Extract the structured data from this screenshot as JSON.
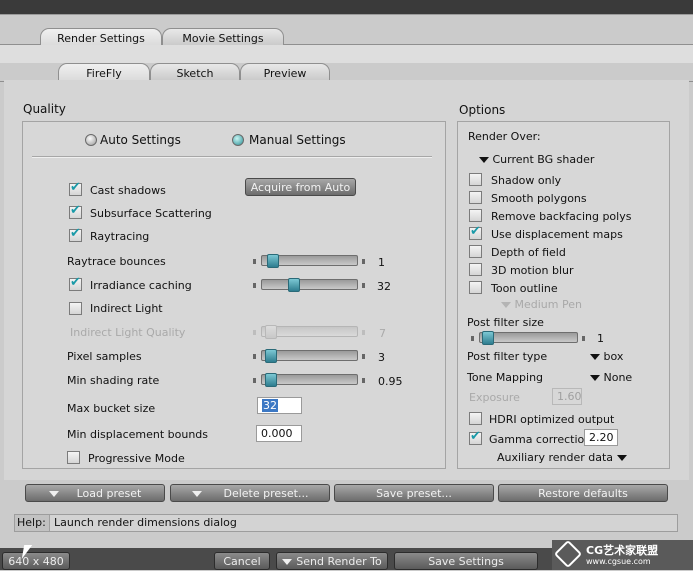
{
  "tabs_top": [
    {
      "label": "Render Settings",
      "active": true
    },
    {
      "label": "Movie Settings",
      "active": false
    }
  ],
  "tabs_sub": [
    {
      "label": "FireFly",
      "active": true
    },
    {
      "label": "Sketch",
      "active": false
    },
    {
      "label": "Preview",
      "active": false
    }
  ],
  "quality": {
    "title": "Quality",
    "auto_label": "Auto Settings",
    "manual_label": "Manual Settings",
    "mode": "manual",
    "cast_shadows": "Cast shadows",
    "subsurface": "Subsurface Scattering",
    "raytracing": "Raytracing",
    "acquire_button": "Acquire from Auto",
    "raytrace_bounces_label": "Raytrace bounces",
    "raytrace_bounces_value": "1",
    "irradiance_label": "Irradiance caching",
    "irradiance_value": "32",
    "indirect_light": "Indirect Light",
    "indirect_quality_label": "Indirect Light Quality",
    "indirect_quality_value": "7",
    "pixel_samples_label": "Pixel samples",
    "pixel_samples_value": "3",
    "min_shading_label": "Min shading rate",
    "min_shading_value": "0.95",
    "max_bucket_label": "Max bucket size",
    "max_bucket_value": "32",
    "min_disp_label": "Min displacement bounds",
    "min_disp_value": "0.000",
    "progressive_label": "Progressive Mode"
  },
  "options": {
    "title": "Options",
    "render_over_label": "Render Over:",
    "render_over_value": "Current BG shader",
    "shadow_only": "Shadow only",
    "smooth_polygons": "Smooth polygons",
    "remove_backfacing": "Remove backfacing polys",
    "use_displacement": "Use displacement maps",
    "depth_of_field": "Depth of field",
    "motion_blur": "3D motion blur",
    "toon_outline": "Toon outline",
    "pen_value": "Medium Pen",
    "post_filter_size_label": "Post filter size",
    "post_filter_size_value": "1",
    "post_filter_type_label": "Post filter type",
    "post_filter_type_value": "box",
    "tone_mapping_label": "Tone Mapping",
    "tone_mapping_value": "None",
    "exposure_label": "Exposure",
    "exposure_value": "1.60",
    "hdri_label": "HDRI optimized output",
    "gamma_label": "Gamma correction",
    "gamma_value": "2.20",
    "aux_label": "Auxiliary render data"
  },
  "presets": {
    "load": "Load preset",
    "delete": "Delete preset...",
    "save": "Save preset...",
    "restore": "Restore defaults"
  },
  "help": {
    "label": "Help:",
    "text": "Launch render dimensions dialog"
  },
  "footer": {
    "dimensions": "640 x 480",
    "cancel": "Cancel",
    "send_render": "Send Render To",
    "save_settings": "Save Settings"
  },
  "watermark": {
    "brand": "CG艺术家联盟",
    "url": "www.cgsue.com"
  },
  "colors": {
    "panel": "#d5d5d5",
    "accent": "#2e8e9c",
    "button_dark": "#6c6c6c"
  }
}
